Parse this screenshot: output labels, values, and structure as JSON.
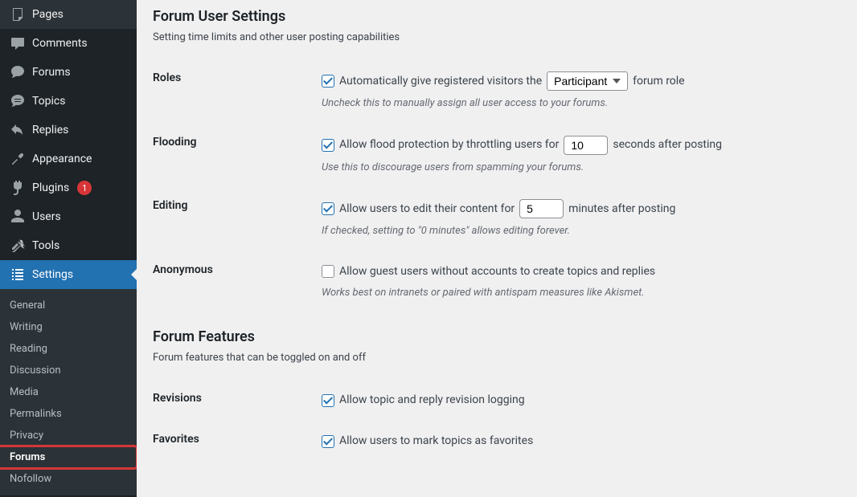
{
  "sidebar": {
    "menu": [
      {
        "key": "pages",
        "label": "Pages",
        "icon": "pages"
      },
      {
        "key": "comments",
        "label": "Comments",
        "icon": "comments"
      },
      {
        "key": "forums",
        "label": "Forums",
        "icon": "forums-bbp"
      },
      {
        "key": "topics",
        "label": "Topics",
        "icon": "topics"
      },
      {
        "key": "replies",
        "label": "Replies",
        "icon": "replies"
      },
      {
        "key": "appearance",
        "label": "Appearance",
        "icon": "appearance"
      },
      {
        "key": "plugins",
        "label": "Plugins",
        "icon": "plugins",
        "badge": "1"
      },
      {
        "key": "users",
        "label": "Users",
        "icon": "users"
      },
      {
        "key": "tools",
        "label": "Tools",
        "icon": "tools"
      },
      {
        "key": "settings",
        "label": "Settings",
        "icon": "settings",
        "current": true
      }
    ],
    "submenu": [
      {
        "key": "general",
        "label": "General"
      },
      {
        "key": "writing",
        "label": "Writing"
      },
      {
        "key": "reading",
        "label": "Reading"
      },
      {
        "key": "discussion",
        "label": "Discussion"
      },
      {
        "key": "media",
        "label": "Media"
      },
      {
        "key": "permalinks",
        "label": "Permalinks"
      },
      {
        "key": "privacy",
        "label": "Privacy"
      },
      {
        "key": "forums",
        "label": "Forums",
        "current": true,
        "annotated": true
      },
      {
        "key": "nofollow",
        "label": "Nofollow"
      }
    ]
  },
  "sections": {
    "user": {
      "title": "Forum User Settings",
      "desc": "Setting time limits and other user posting capabilities"
    },
    "features": {
      "title": "Forum Features",
      "desc": "Forum features that can be toggled on and off"
    }
  },
  "fields": {
    "roles": {
      "label": "Roles",
      "checked": true,
      "pre": "Automatically give registered visitors the",
      "post": "forum role",
      "select_value": "Participant",
      "desc": "Uncheck this to manually assign all user access to your forums."
    },
    "flooding": {
      "label": "Flooding",
      "checked": true,
      "pre": "Allow flood protection by throttling users for",
      "value": "10",
      "post": "seconds after posting",
      "desc": "Use this to discourage users from spamming your forums."
    },
    "editing": {
      "label": "Editing",
      "checked": true,
      "pre": "Allow users to edit their content for",
      "value": "5",
      "post": "minutes after posting",
      "desc": "If checked, setting to \"0 minutes\" allows editing forever."
    },
    "anonymous": {
      "label": "Anonymous",
      "checked": false,
      "text": "Allow guest users without accounts to create topics and replies",
      "desc": "Works best on intranets or paired with antispam measures like Akismet."
    },
    "revisions": {
      "label": "Revisions",
      "checked": true,
      "text": "Allow topic and reply revision logging"
    },
    "favorites": {
      "label": "Favorites",
      "checked": true,
      "text": "Allow users to mark topics as favorites"
    }
  }
}
